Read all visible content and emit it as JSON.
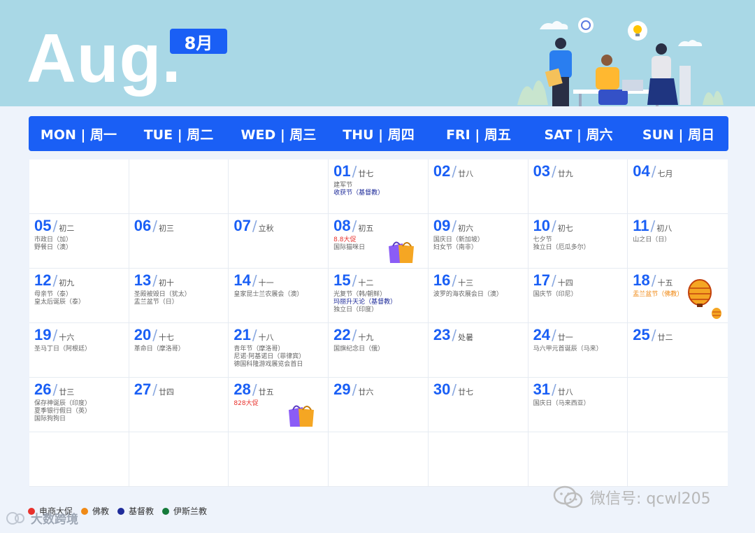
{
  "banner": {
    "month_en": "Aug.",
    "month_cn": "8月"
  },
  "weekdays": [
    "MON | 周一",
    "TUE | 周二",
    "WED | 周三",
    "THU | 周四",
    "FRI | 周五",
    "SAT | 周六",
    "SUN | 周日"
  ],
  "cells": [
    {
      "day": "",
      "lunar": "",
      "events": []
    },
    {
      "day": "",
      "lunar": "",
      "events": []
    },
    {
      "day": "",
      "lunar": "",
      "events": []
    },
    {
      "day": "01",
      "lunar": "廿七",
      "events": [
        {
          "text": "建军节",
          "type": "gray"
        },
        {
          "text": "收获节（基督教）",
          "type": "blue"
        }
      ]
    },
    {
      "day": "02",
      "lunar": "廿八",
      "events": []
    },
    {
      "day": "03",
      "lunar": "廿九",
      "events": []
    },
    {
      "day": "04",
      "lunar": "七月",
      "events": []
    },
    {
      "day": "05",
      "lunar": "初二",
      "events": [
        {
          "text": "市政日（加）",
          "type": "gray"
        },
        {
          "text": "野餐日（澳）",
          "type": "gray"
        }
      ]
    },
    {
      "day": "06",
      "lunar": "初三",
      "events": []
    },
    {
      "day": "07",
      "lunar": "立秋",
      "events": []
    },
    {
      "day": "08",
      "lunar": "初五",
      "events": [
        {
          "text": "8.8大促",
          "type": "red"
        },
        {
          "text": "国际猫咪日",
          "type": "gray"
        }
      ],
      "bag": true
    },
    {
      "day": "09",
      "lunar": "初六",
      "events": [
        {
          "text": "国庆日（新加坡）",
          "type": "gray"
        },
        {
          "text": "妇女节（南非）",
          "type": "gray"
        }
      ]
    },
    {
      "day": "10",
      "lunar": "初七",
      "events": [
        {
          "text": "七夕节",
          "type": "gray"
        },
        {
          "text": "独立日（厄瓜多尔）",
          "type": "gray"
        }
      ]
    },
    {
      "day": "11",
      "lunar": "初八",
      "events": [
        {
          "text": "山之日（日）",
          "type": "gray"
        }
      ]
    },
    {
      "day": "12",
      "lunar": "初九",
      "events": [
        {
          "text": "母亲节（泰）",
          "type": "gray"
        },
        {
          "text": "皇太后诞辰（泰）",
          "type": "gray"
        }
      ]
    },
    {
      "day": "13",
      "lunar": "初十",
      "events": [
        {
          "text": "圣殿被毁日（犹太）",
          "type": "gray"
        },
        {
          "text": "盂兰盆节（日）",
          "type": "gray"
        }
      ]
    },
    {
      "day": "14",
      "lunar": "十一",
      "events": [
        {
          "text": "皇家昆士兰农展会（澳）",
          "type": "gray"
        }
      ]
    },
    {
      "day": "15",
      "lunar": "十二",
      "events": [
        {
          "text": "光复节（韩/朝鲜）",
          "type": "gray"
        },
        {
          "text": "玛丽升天论（基督教）",
          "type": "blue"
        },
        {
          "text": "独立日（印度）",
          "type": "gray"
        }
      ]
    },
    {
      "day": "16",
      "lunar": "十三",
      "events": [
        {
          "text": "波罗的海农展会日（澳）",
          "type": "gray"
        }
      ]
    },
    {
      "day": "17",
      "lunar": "十四",
      "events": [
        {
          "text": "国庆节（印尼）",
          "type": "gray"
        }
      ]
    },
    {
      "day": "18",
      "lunar": "十五",
      "events": [
        {
          "text": "盂兰盆节（佛教）",
          "type": "orange"
        }
      ],
      "lantern": true
    },
    {
      "day": "19",
      "lunar": "十六",
      "events": [
        {
          "text": "圣马丁日（阿根廷）",
          "type": "gray"
        }
      ]
    },
    {
      "day": "20",
      "lunar": "十七",
      "events": [
        {
          "text": "革命日（摩洛哥）",
          "type": "gray"
        }
      ]
    },
    {
      "day": "21",
      "lunar": "十八",
      "events": [
        {
          "text": "青年节（摩洛哥）",
          "type": "gray"
        },
        {
          "text": "尼诺·阿基诺日（菲律宾）",
          "type": "gray"
        },
        {
          "text": "德国科隆游戏展览会首日",
          "type": "gray"
        }
      ]
    },
    {
      "day": "22",
      "lunar": "十九",
      "events": [
        {
          "text": "国旗纪念日（俄）",
          "type": "gray"
        }
      ]
    },
    {
      "day": "23",
      "lunar": "处暑",
      "events": []
    },
    {
      "day": "24",
      "lunar": "廿一",
      "events": [
        {
          "text": "马六甲元首诞辰（马来）",
          "type": "gray"
        }
      ]
    },
    {
      "day": "25",
      "lunar": "廿二",
      "events": []
    },
    {
      "day": "26",
      "lunar": "廿三",
      "events": [
        {
          "text": "保存神诞辰（印度）",
          "type": "gray"
        },
        {
          "text": "夏季银行假日（英）",
          "type": "gray"
        },
        {
          "text": "国际狗狗日",
          "type": "gray"
        }
      ]
    },
    {
      "day": "27",
      "lunar": "廿四",
      "events": []
    },
    {
      "day": "28",
      "lunar": "廿五",
      "events": [
        {
          "text": "828大促",
          "type": "red"
        }
      ],
      "bag": true
    },
    {
      "day": "29",
      "lunar": "廿六",
      "events": []
    },
    {
      "day": "30",
      "lunar": "廿七",
      "events": []
    },
    {
      "day": "31",
      "lunar": "廿八",
      "events": [
        {
          "text": "国庆日（马来西亚）",
          "type": "gray"
        }
      ]
    },
    {
      "day": "",
      "lunar": "",
      "events": []
    },
    {
      "day": "",
      "lunar": "",
      "events": []
    },
    {
      "day": "",
      "lunar": "",
      "events": []
    },
    {
      "day": "",
      "lunar": "",
      "events": []
    },
    {
      "day": "",
      "lunar": "",
      "events": []
    },
    {
      "day": "",
      "lunar": "",
      "events": []
    },
    {
      "day": "",
      "lunar": "",
      "events": []
    },
    {
      "day": "",
      "lunar": "",
      "events": []
    }
  ],
  "legend": [
    {
      "label": "电商大促",
      "color": "#e8302b"
    },
    {
      "label": "佛教",
      "color": "#f08a16"
    },
    {
      "label": "基督教",
      "color": "#1e2b9a"
    },
    {
      "label": "伊斯兰教",
      "color": "#157a3a"
    }
  ],
  "watermark": {
    "wechat": "微信号: qcwl205",
    "logo_text": "大数跨境"
  },
  "colors": {
    "accent": "#1a5ff5",
    "banner_bg": "#a9d8e6"
  }
}
